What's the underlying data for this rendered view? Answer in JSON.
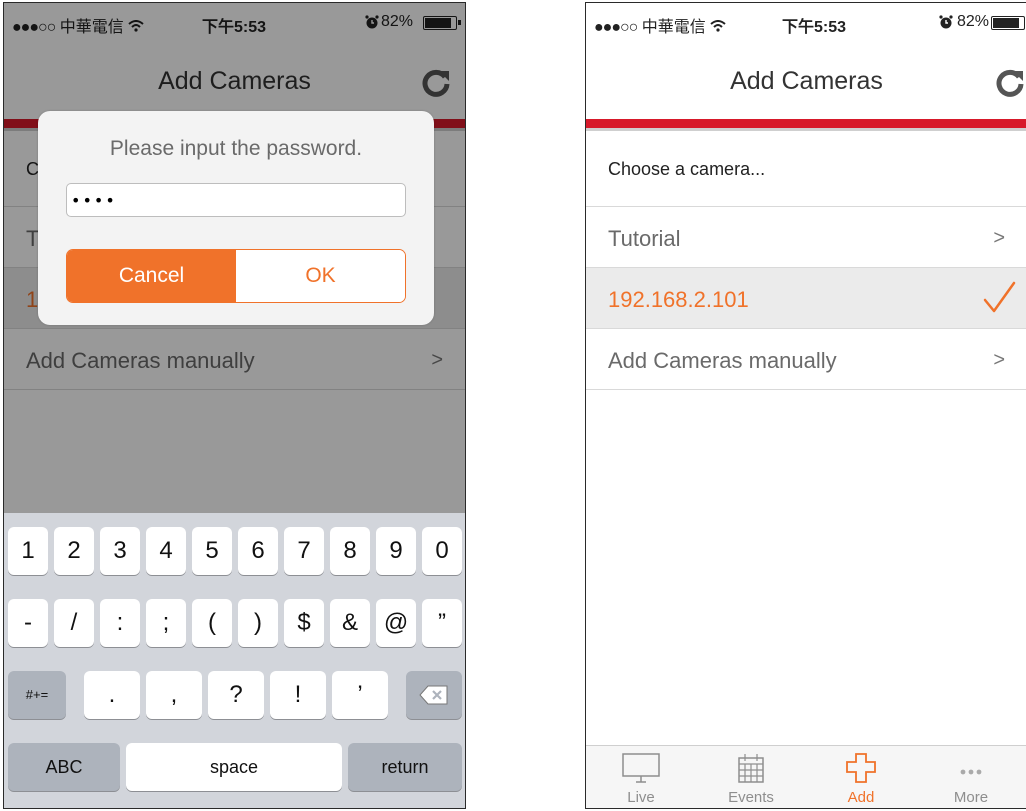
{
  "left_screen": {
    "status": {
      "carrier": "中華電信",
      "time": "下午5:53",
      "battery": "82%",
      "battery_level": 0.82
    },
    "nav_title": "Add Cameras",
    "background_rows": [
      {
        "label": "C"
      },
      {
        "label": "T"
      },
      {
        "label": "1"
      },
      {
        "label": "Add Cameras manually"
      }
    ],
    "alert": {
      "message": "Please input the password.",
      "password_value": "1234",
      "cancel_label": "Cancel",
      "ok_label": "OK"
    },
    "keyboard": {
      "row1": [
        "1",
        "2",
        "3",
        "4",
        "5",
        "6",
        "7",
        "8",
        "9",
        "0"
      ],
      "row2": [
        "-",
        "/",
        ":",
        ";",
        "(",
        ")",
        "$",
        "&",
        "@",
        "”"
      ],
      "row3": [
        "#+=",
        ".",
        ",",
        "?",
        "!",
        "’"
      ],
      "row4": {
        "abc": "ABC",
        "space": "space",
        "return": "return"
      }
    }
  },
  "right_screen": {
    "status": {
      "carrier": "中華電信",
      "time": "下午5:53",
      "battery": "82%",
      "battery_level": 0.82
    },
    "nav_title": "Add Cameras",
    "list_header": "Choose a camera...",
    "rows": [
      {
        "label": "Tutorial",
        "accessory": "chevron"
      },
      {
        "label": "192.168.2.101",
        "accessory": "checkmark",
        "selected": true
      },
      {
        "label": "Add Cameras manually",
        "accessory": "chevron"
      }
    ],
    "tabs": [
      {
        "label": "Live",
        "icon": "monitor-icon"
      },
      {
        "label": "Events",
        "icon": "calendar-icon"
      },
      {
        "label": "Add",
        "icon": "plus-icon",
        "active": true
      },
      {
        "label": "More",
        "icon": "more-dots-icon"
      }
    ]
  },
  "colors": {
    "accent": "#f0722a",
    "red_bar": "#d7192a",
    "selected_row": "#ebebeb"
  }
}
